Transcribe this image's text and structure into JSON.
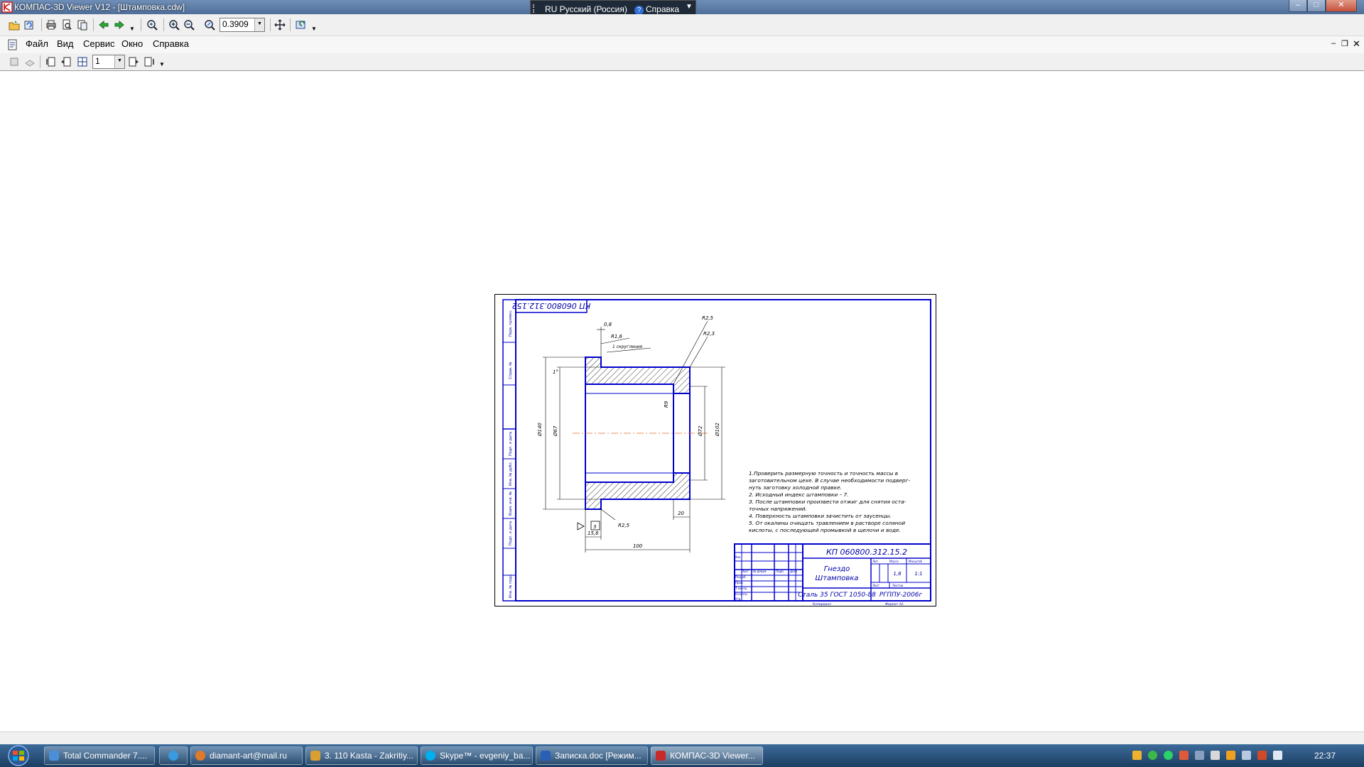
{
  "window": {
    "title": "КОМПАС-3D Viewer V12 - [Штамповка.cdw]"
  },
  "langbar": {
    "language": "RU Русский (Россия)",
    "help": "Справка",
    "help_icon": "help-icon"
  },
  "toolbar": {
    "zoom_value": "0.3909",
    "page_value": "1"
  },
  "menu": {
    "items": [
      "Файл",
      "Вид",
      "Сервис",
      "Окно",
      "Справка"
    ]
  },
  "drawing": {
    "stamp_mirrored": "КП 060800.312.152",
    "designation": "КП 060800.312.15.2",
    "part_name_1": "Гнездо",
    "part_name_2": "Штамповка",
    "material": "Сталь 35 ГОСТ 1050-88",
    "organization": "РГППУ-2006г",
    "sheet_mass": "1,8",
    "sheet_scale": "1:1",
    "copied": "Копировал",
    "format": "Формат  А3",
    "dims": {
      "d08": "0,8",
      "r16": "R1,6",
      "r25_top": "R2,5",
      "r23": "R2,3",
      "flat_note": "1 скругления",
      "d91": "R9",
      "d102": "Ø102",
      "d72": "Ø72",
      "d140": "Ø140",
      "d67": "Ø67",
      "r25_bottom": "R2,5",
      "d20": "20",
      "d15": "15,6",
      "d100": "100",
      "d3": "3",
      "angle": "1°"
    },
    "notes": [
      "1.Проверить размерную точность и точность массы в",
      "заготовительном цехе. В случае необходимости подверг-",
      "нуть заготовку холодной правке.",
      "2. Исходный индекс штамповки – 7.",
      "3. После штамповки произвести отжиг для снятия оста-",
      "точных напряжений.",
      "4. Поверхность штамповки зачистить от заусенцы.",
      "5. От окалины очищать травлением в растворе соляной",
      "кислоты, с последующей промывкой в щелочи и воде."
    ],
    "title_cells": [
      "Изм",
      "Лист",
      "№ докум.",
      "Подп.",
      "Дата",
      "Разраб.",
      "Пров.",
      "Т.контр.",
      "Н.контр.",
      "Утв.",
      "Лит.",
      "Масса",
      "Масштаб",
      "Лист",
      "Листов"
    ],
    "side_labels": [
      "Перв. примен.",
      "Справ. №",
      "Подп. и дата",
      "Инв. № дубл.",
      "Взам. инв. №",
      "Подп. и дата",
      "Инв. № подл."
    ]
  },
  "taskbar": {
    "items": [
      {
        "label": "Total Commander 7....",
        "icon": "floppy-icon",
        "color": "#4a8fd8"
      },
      {
        "label": "",
        "icon": "ie-icon",
        "color": "#3a9ae0"
      },
      {
        "label": "diamant-art@mail.ru",
        "icon": "mail-icon",
        "color": "#e07a2a"
      },
      {
        "label": "3. 110 Kasta - Zakritiy...",
        "icon": "media-icon",
        "color": "#d8a030"
      },
      {
        "label": "Skype™ - evgeniy_ba...",
        "icon": "skype-icon",
        "color": "#00aff0"
      },
      {
        "label": "Записка.doc [Режим...",
        "icon": "word-icon",
        "color": "#2a5fb8"
      },
      {
        "label": "КОМПАС-3D Viewer...",
        "icon": "kompas-icon",
        "color": "#c82a2a"
      }
    ],
    "clock": "22:37"
  }
}
